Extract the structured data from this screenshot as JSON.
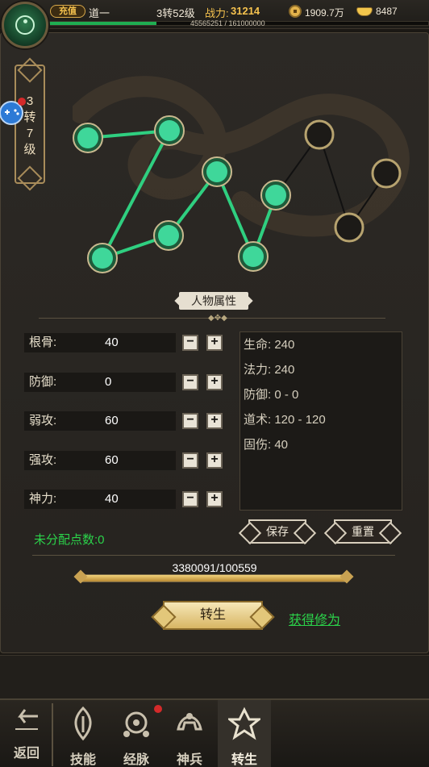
{
  "header": {
    "vip_label": "充值",
    "player_name": "道一",
    "level": "3转52级",
    "power_label": "战力:",
    "power_value": "31214",
    "gold": "1909.7万",
    "ingot": "8487",
    "exp_text": "45565251 / 161000000",
    "exp_fraction": 0.283
  },
  "side_badge": {
    "line1": "3",
    "line2": "转",
    "line3": "7",
    "line4": "级"
  },
  "meridian": {
    "lit_points": 7,
    "dark_points": 3
  },
  "section": {
    "title": "人物属性"
  },
  "stats": [
    {
      "label": "根骨:",
      "value": "40"
    },
    {
      "label": "防御:",
      "value": "0"
    },
    {
      "label": "弱攻:",
      "value": "60"
    },
    {
      "label": "强攻:",
      "value": "60"
    },
    {
      "label": "神力:",
      "value": "40"
    }
  ],
  "stat_buttons": {
    "minus": "−",
    "plus": "+"
  },
  "attributes": [
    "生命: 240",
    "法力: 240",
    "防御: 0 - 0",
    "道术: 120 - 120",
    "固伤: 40"
  ],
  "unassigned": "未分配点数:0",
  "buttons": {
    "save": "保存",
    "reset": "重置",
    "rebirth": "转生",
    "get_cultivation": "获得修为"
  },
  "progress": {
    "text": "3380091/100559",
    "fraction": 1.0
  },
  "nav": {
    "back": "返回",
    "items": [
      "技能",
      "经脉",
      "神兵",
      "转生"
    ],
    "active": "转生"
  },
  "colors": {
    "accent_green": "#2bd24a",
    "gold": "#f5c24e",
    "jade": "#1fae52",
    "notification_red": "#d42a2a"
  }
}
